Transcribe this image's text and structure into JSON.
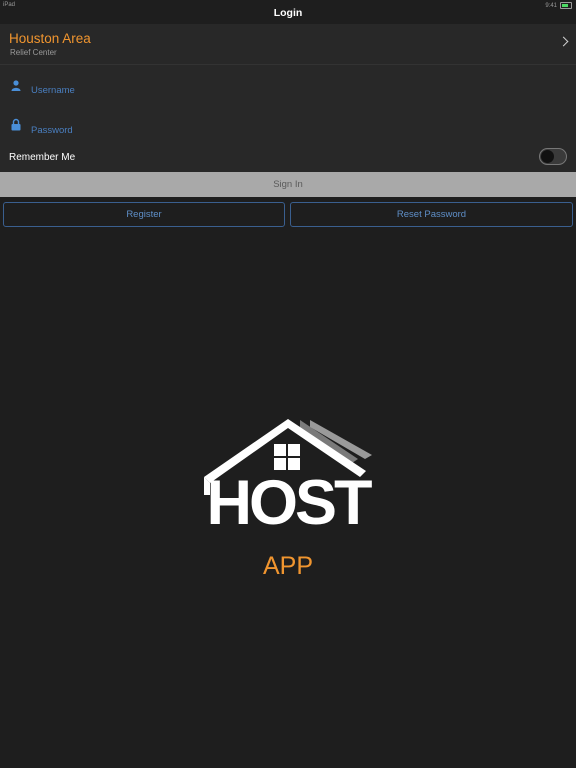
{
  "status_bar": {
    "left": "iPad",
    "right": "9:41"
  },
  "nav": {
    "title": "Login"
  },
  "organization": {
    "name": "Houston Area",
    "subtitle": "Relief Center"
  },
  "form": {
    "username_placeholder": "Username",
    "password_placeholder": "Password",
    "remember_label": "Remember Me",
    "remember_enabled": false
  },
  "buttons": {
    "sign_in": "Sign In",
    "register": "Register",
    "reset_password": "Reset Password"
  },
  "logo": {
    "wordmark": "HOST",
    "subtitle": "APP"
  },
  "colors": {
    "accent": "#f0952f",
    "link": "#4a8fd8",
    "background": "#1e1e1e"
  },
  "icons": [
    "person-icon",
    "lock-icon",
    "chevron-right-icon",
    "house-logo-icon"
  ]
}
